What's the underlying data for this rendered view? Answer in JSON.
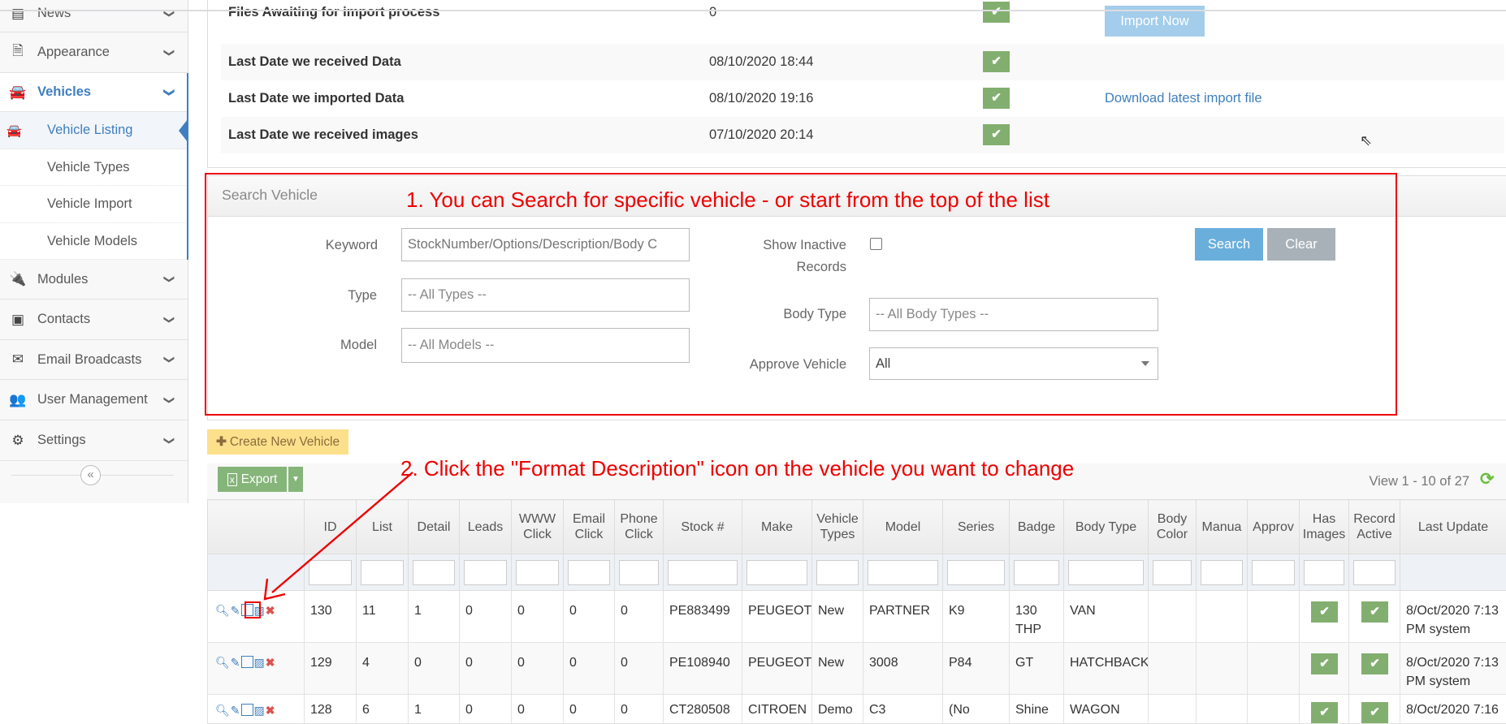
{
  "sidebar": {
    "items": [
      {
        "label": "News",
        "icon": "newspaper-icon"
      },
      {
        "label": "Appearance",
        "icon": "file-icon"
      },
      {
        "label": "Vehicles",
        "icon": "car-icon"
      },
      {
        "label": "Modules",
        "icon": "plug-icon"
      },
      {
        "label": "Contacts",
        "icon": "address-book-icon"
      },
      {
        "label": "Email Broadcasts",
        "icon": "envelope-icon"
      },
      {
        "label": "User Management",
        "icon": "users-icon"
      },
      {
        "label": "Settings",
        "icon": "cogs-icon"
      }
    ],
    "subitems": [
      {
        "label": "Vehicle Listing"
      },
      {
        "label": "Vehicle Types"
      },
      {
        "label": "Vehicle Import"
      },
      {
        "label": "Vehicle Models"
      }
    ],
    "collapse": "«"
  },
  "status": {
    "rows": [
      {
        "label": "Files Awaiting for import process",
        "value": "0",
        "action": "Import Now"
      },
      {
        "label": "Last Date we received Data",
        "value": "08/10/2020 18:44",
        "action": ""
      },
      {
        "label": "Last Date we imported Data",
        "value": "08/10/2020 19:16",
        "action": "Download latest import file"
      },
      {
        "label": "Last Date we received images",
        "value": "07/10/2020 20:14",
        "action": ""
      }
    ]
  },
  "search": {
    "title": "Search Vehicle",
    "keyword_label": "Keyword",
    "keyword_placeholder": "StockNumber/Options/Description/Body C",
    "type_label": "Type",
    "type_value": "-- All Types --",
    "model_label": "Model",
    "model_value": "-- All Models --",
    "inactive_label_1": "Show Inactive",
    "inactive_label_2": "Records",
    "bodytype_label": "Body Type",
    "bodytype_value": "-- All Body Types --",
    "approve_label": "Approve Vehicle",
    "approve_value": "All",
    "search_btn": "Search",
    "clear_btn": "Clear"
  },
  "annotations": {
    "one": "1. You can Search for specific vehicle - or start from the top of the list",
    "two": "2. Click the \"Format Description\" icon on the vehicle you want to change"
  },
  "toolbar": {
    "create": "Create New Vehicle",
    "export": "Export",
    "view": "View 1 - 10 of 27"
  },
  "table": {
    "headers": [
      "",
      "ID",
      "List",
      "Detail",
      "Leads",
      "WWW Click",
      "Email Click",
      "Phone Click",
      "Stock #",
      "Make",
      "Vehicle Types",
      "Model",
      "Series",
      "Badge",
      "Body Type",
      "Body Color",
      "Manua",
      "Approv",
      "Has Images",
      "Record Active",
      "Last Update"
    ],
    "rows": [
      [
        "130",
        "11",
        "1",
        "0",
        "0",
        "0",
        "0",
        "PE883499",
        "PEUGEOT",
        "New",
        "PARTNER",
        "K9",
        "130 THP",
        "VAN",
        "",
        "",
        "",
        "✔",
        "✔",
        "8/Oct/2020 7:13 PM system"
      ],
      [
        "129",
        "4",
        "0",
        "0",
        "0",
        "0",
        "0",
        "PE108940",
        "PEUGEOT",
        "New",
        "3008",
        "P84",
        "GT",
        "HATCHBACK",
        "",
        "",
        "",
        "✔",
        "✔",
        "8/Oct/2020 7:13 PM system"
      ],
      [
        "128",
        "6",
        "1",
        "0",
        "0",
        "0",
        "0",
        "CT280508",
        "CITROEN",
        "Demo",
        "C3",
        "(No",
        "Shine",
        "WAGON",
        "",
        "",
        "",
        "✔",
        "✔",
        "8/Oct/2020 7:16"
      ]
    ]
  },
  "colors": {
    "accent": "#3f7fbf",
    "check": "#82af6f",
    "annotation": "#ee0000",
    "create": "#fde08c",
    "search": "#6aaedc",
    "clear": "#a8b1b8"
  }
}
